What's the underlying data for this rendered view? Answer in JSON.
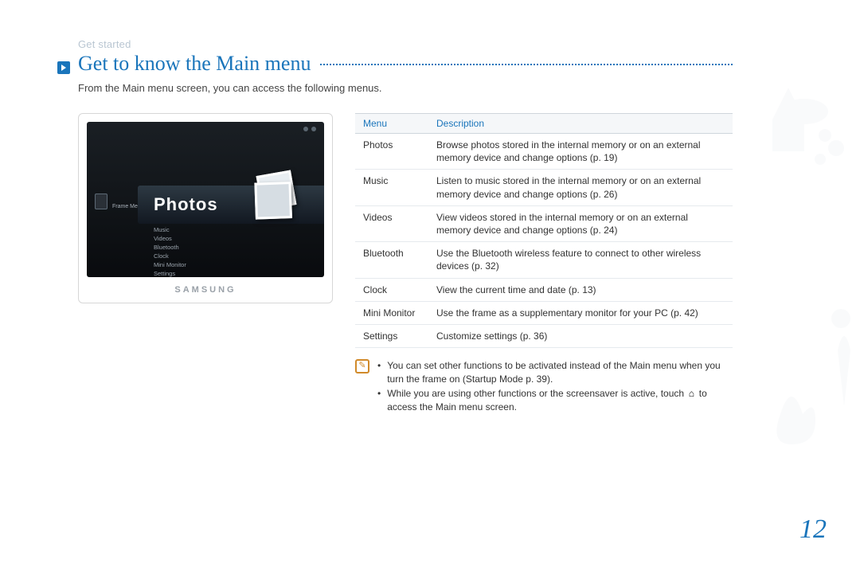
{
  "breadcrumb": "Get started",
  "title": "Get to know the Main menu",
  "intro": "From the Main menu screen, you can access the following menus.",
  "device": {
    "frame_memory_label": "Frame Memory",
    "selected_menu": "Photos",
    "brand": "SAMSUNG",
    "menu_items": [
      "Music",
      "Videos",
      "Bluetooth",
      "Clock",
      "Mini Monitor",
      "Settings"
    ]
  },
  "table": {
    "headers": {
      "menu": "Menu",
      "description": "Description"
    },
    "rows": [
      {
        "menu": "Photos",
        "description": "Browse photos stored in the internal memory or on an external memory device and change options (p. 19)"
      },
      {
        "menu": "Music",
        "description": "Listen to music stored in the internal memory or on an external memory device and change options (p. 26)"
      },
      {
        "menu": "Videos",
        "description": "View videos stored in the internal memory or on an external memory device and change options (p. 24)"
      },
      {
        "menu": "Bluetooth",
        "description": "Use the Bluetooth wireless feature to connect to other wireless devices (p. 32)"
      },
      {
        "menu": "Clock",
        "description": "View the current time and date (p. 13)"
      },
      {
        "menu": "Mini Monitor",
        "description": "Use the frame as a supplementary monitor for your PC (p. 42)"
      },
      {
        "menu": "Settings",
        "description": "Customize settings (p. 36)"
      }
    ]
  },
  "notes": {
    "bullet1": "You can set other functions to be activated instead of the Main menu when you turn the frame on (Startup Mode p. 39).",
    "bullet2_pre": "While you are using other functions or the screensaver is active, touch ",
    "bullet2_post": " to access the Main menu screen."
  },
  "page_number": "12"
}
